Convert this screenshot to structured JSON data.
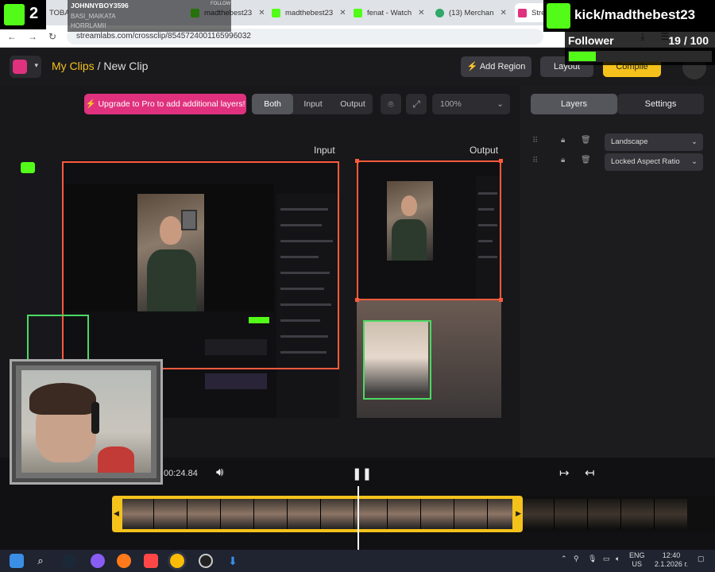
{
  "browser": {
    "tabs": [
      {
        "label": "TOBA",
        "color": "#9a9a9a"
      },
      {
        "label": "madthebest23",
        "color": "#53fc18"
      },
      {
        "label": "madthebest23",
        "color": "#53fc18"
      },
      {
        "label": "fenat - Watch",
        "color": "#53fc18"
      },
      {
        "label": "(13) Merchan",
        "color": "#2fa86a"
      },
      {
        "label": "Strea",
        "color": "#e0317e"
      }
    ],
    "url": "streamlabs.com/crossclip/8545724001165996032"
  },
  "overlay": {
    "kick_channel": "kick/madthebest23",
    "follower_label": "Follower",
    "follower_count": "19 / 100",
    "follower_progress": 0.19,
    "k2_label": "2",
    "chip_user": "JOHNNYBOY3596",
    "chip_line2": "BASI_MAIKATA",
    "chip_line3": "HORRLAMII",
    "chip_follow": "FOLLOW"
  },
  "header": {
    "link": "My Clips",
    "separator": "/",
    "page": "New Clip",
    "add_region": "Add Region",
    "layout": "Layout",
    "compile": "Compile"
  },
  "toolbar": {
    "upgrade": "Upgrade to Pro to add additional layers!",
    "view_modes": [
      "Both",
      "Input",
      "Output"
    ],
    "active_mode": "Both",
    "zoom": "100%"
  },
  "canvas": {
    "input_label": "Input",
    "output_label": "Output"
  },
  "panel": {
    "tabs": [
      "Layers",
      "Settings"
    ],
    "active_tab": "Layers",
    "layers": [
      {
        "value": "Landscape"
      },
      {
        "value": "Locked Aspect Ratio"
      }
    ]
  },
  "playback": {
    "timecode": "00:24.84"
  },
  "taskbar": {
    "lang": "ENG",
    "region": "US",
    "time": "12:40",
    "date": "2.1.2026 г."
  },
  "colors": {
    "accent": "#f4c21b",
    "pink": "#e0317e",
    "kick_green": "#53fc18",
    "region_orange": "#ff5a3c",
    "region_green": "#4cd964"
  }
}
